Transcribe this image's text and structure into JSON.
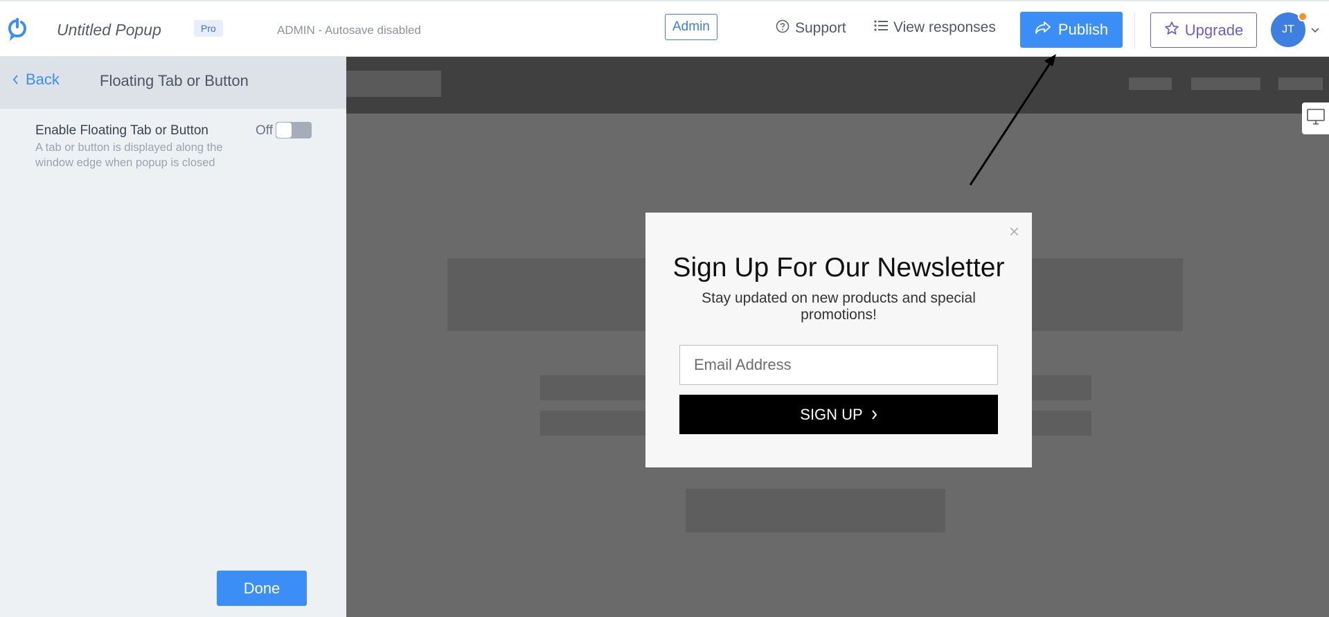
{
  "header": {
    "app_title": "Untitled Popup",
    "pro_badge": "Pro",
    "autosave_status": "ADMIN - Autosave disabled",
    "admin_label": "Admin",
    "support_label": "Support",
    "view_responses_label": "View responses",
    "publish_label": "Publish",
    "upgrade_label": "Upgrade",
    "avatar_initials": "JT"
  },
  "panel": {
    "back_label": "Back",
    "title": "Floating Tab or Button",
    "option": {
      "label": "Enable Floating Tab or Button",
      "description": "A tab or button is displayed along the window edge when popup is closed",
      "toggle_state": "Off"
    },
    "done_label": "Done"
  },
  "popup": {
    "close_glyph": "×",
    "title": "Sign Up For Our Newsletter",
    "subtitle": "Stay updated on new products and special promotions!",
    "email_placeholder": "Email Address",
    "signup_label": "SIGN UP"
  },
  "colors": {
    "accent": "#3a8ef6",
    "upgrade": "#6b5bd6",
    "avatar_status": "#f5902a",
    "panel_bg": "#eef1f4",
    "preview_bg": "#6a6a6a"
  },
  "icons": [
    "logo-icon",
    "help-circle-icon",
    "list-icon",
    "share-icon",
    "star-icon",
    "chevron-down-icon",
    "chevron-left-icon",
    "chevron-right-icon",
    "monitor-icon",
    "close-icon"
  ]
}
